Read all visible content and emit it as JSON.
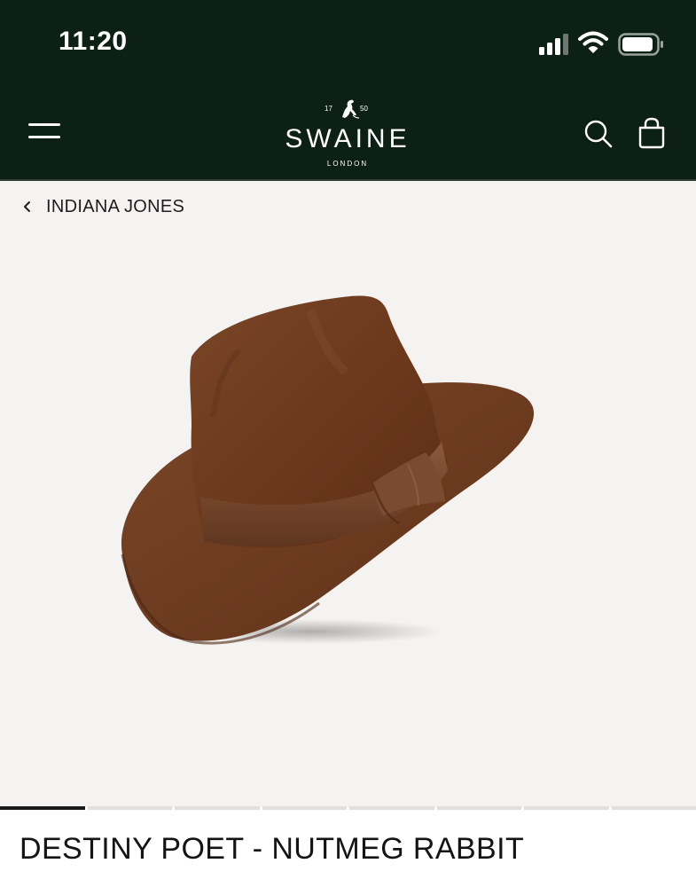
{
  "status_bar": {
    "time": "11:20"
  },
  "header": {
    "logo": {
      "year_left": "17",
      "year_right": "50",
      "name": "SWAINE",
      "subtitle": "LONDON"
    },
    "icons": {
      "menu": "hamburger-menu-icon",
      "search": "search-icon",
      "bag": "shopping-bag-icon"
    }
  },
  "breadcrumb": {
    "label": "INDIANA JONES"
  },
  "gallery": {
    "image_alt": "Brown fedora hat with grosgrain band",
    "slide_count": 8,
    "active_slide": 1
  },
  "product": {
    "title": "DESTINY POET - NUTMEG RABBIT"
  },
  "colors": {
    "header_bg": "#0c2016",
    "content_bg": "#f4f3f1",
    "hat_brown": "#6e3c20"
  }
}
